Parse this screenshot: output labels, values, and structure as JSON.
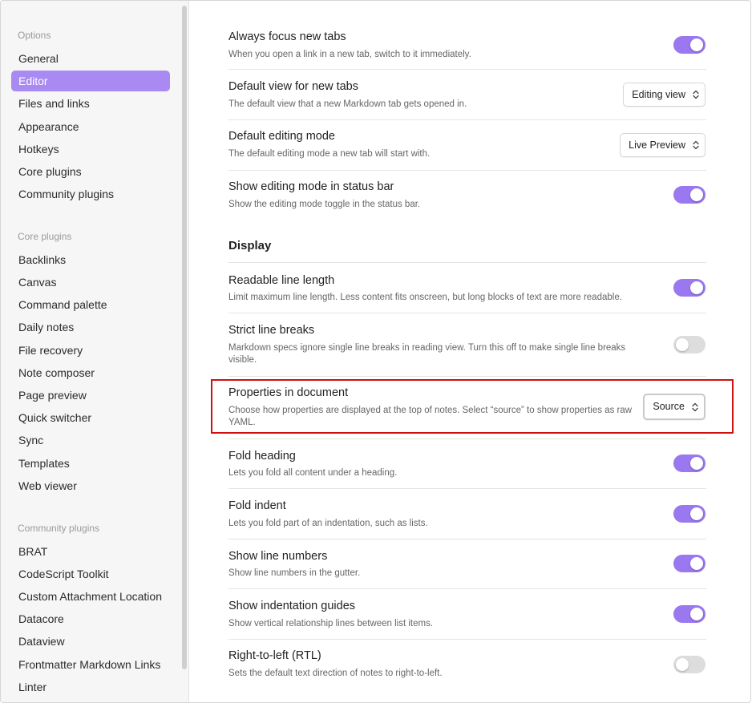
{
  "sidebar": {
    "options_heading": "Options",
    "options": [
      "General",
      "Editor",
      "Files and links",
      "Appearance",
      "Hotkeys",
      "Core plugins",
      "Community plugins"
    ],
    "core_heading": "Core plugins",
    "core": [
      "Backlinks",
      "Canvas",
      "Command palette",
      "Daily notes",
      "File recovery",
      "Note composer",
      "Page preview",
      "Quick switcher",
      "Sync",
      "Templates",
      "Web viewer"
    ],
    "community_heading": "Community plugins",
    "community": [
      "BRAT",
      "CodeScript Toolkit",
      "Custom Attachment Location",
      "Datacore",
      "Dataview",
      "Frontmatter Markdown Links",
      "Linter"
    ],
    "active_item": "Editor"
  },
  "settings": {
    "always_focus": {
      "title": "Always focus new tabs",
      "desc": "When you open a link in a new tab, switch to it immediately.",
      "enabled": true
    },
    "default_view": {
      "title": "Default view for new tabs",
      "desc": "The default view that a new Markdown tab gets opened in.",
      "value": "Editing view"
    },
    "default_mode": {
      "title": "Default editing mode",
      "desc": "The default editing mode a new tab will start with.",
      "value": "Live Preview"
    },
    "show_mode": {
      "title": "Show editing mode in status bar",
      "desc": "Show the editing mode toggle in the status bar.",
      "enabled": true
    },
    "display_heading": "Display",
    "readable": {
      "title": "Readable line length",
      "desc": "Limit maximum line length. Less content fits onscreen, but long blocks of text are more readable.",
      "enabled": true
    },
    "strict": {
      "title": "Strict line breaks",
      "desc": "Markdown specs ignore single line breaks in reading view. Turn this off to make single line breaks visible.",
      "enabled": false
    },
    "properties": {
      "title": "Properties in document",
      "desc": "Choose how properties are displayed at the top of notes. Select “source” to show properties as raw YAML.",
      "value": "Source"
    },
    "fold_heading": {
      "title": "Fold heading",
      "desc": "Lets you fold all content under a heading.",
      "enabled": true
    },
    "fold_indent": {
      "title": "Fold indent",
      "desc": "Lets you fold part of an indentation, such as lists.",
      "enabled": true
    },
    "line_numbers": {
      "title": "Show line numbers",
      "desc": "Show line numbers in the gutter.",
      "enabled": true
    },
    "indent_guides": {
      "title": "Show indentation guides",
      "desc": "Show vertical relationship lines between list items.",
      "enabled": true
    },
    "rtl": {
      "title": "Right-to-left (RTL)",
      "desc": "Sets the default text direction of notes to right-to-left.",
      "enabled": false
    }
  },
  "colors": {
    "accent": "#a98af2",
    "toggle_on": "#9a78ef",
    "highlight": "#d10f0f"
  }
}
